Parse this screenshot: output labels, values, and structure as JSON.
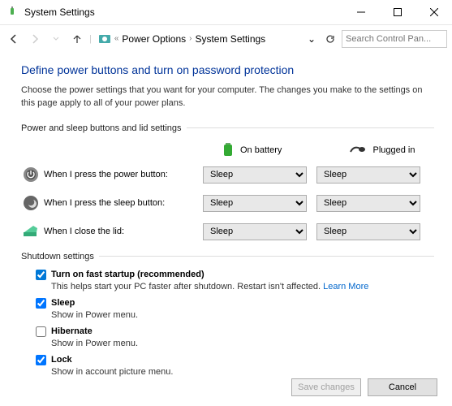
{
  "window": {
    "title": "System Settings"
  },
  "breadcrumb": {
    "item1": "Power Options",
    "item2": "System Settings"
  },
  "search": {
    "placeholder": "Search Control Pan..."
  },
  "heading": "Define power buttons and turn on password protection",
  "intro": "Choose the power settings that you want for your computer. The changes you make to the settings on this page apply to all of your power plans.",
  "groups": {
    "buttons_lid": "Power and sleep buttons and lid settings",
    "shutdown": "Shutdown settings"
  },
  "columns": {
    "battery": "On battery",
    "plugged": "Plugged in"
  },
  "rows": {
    "power": {
      "label": "When I press the power button:",
      "battery": "Sleep",
      "plugged": "Sleep"
    },
    "sleep": {
      "label": "When I press the sleep button:",
      "battery": "Sleep",
      "plugged": "Sleep"
    },
    "lid": {
      "label": "When I close the lid:",
      "battery": "Sleep",
      "plugged": "Sleep"
    }
  },
  "shutdown_items": {
    "fast": {
      "label": "Turn on fast startup (recommended)",
      "desc": "This helps start your PC faster after shutdown. Restart isn't affected. ",
      "link": "Learn More",
      "checked": true
    },
    "sleep": {
      "label": "Sleep",
      "desc": "Show in Power menu.",
      "checked": true
    },
    "hibernate": {
      "label": "Hibernate",
      "desc": "Show in Power menu.",
      "checked": false
    },
    "lock": {
      "label": "Lock",
      "desc": "Show in account picture menu.",
      "checked": true
    }
  },
  "footer": {
    "save": "Save changes",
    "cancel": "Cancel"
  }
}
